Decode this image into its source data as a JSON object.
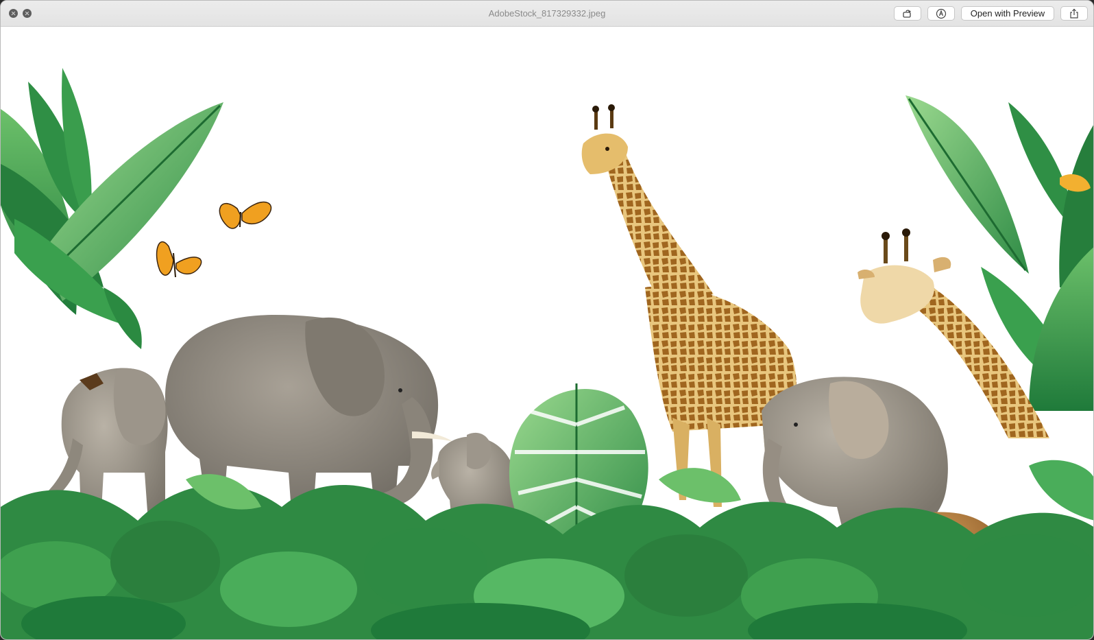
{
  "window": {
    "title": "AdobeStock_817329332.jpeg"
  },
  "toolbar": {
    "open_with_label": "Open with Preview",
    "rotate_icon": "rotate-icon",
    "markup_icon": "markup-pen-icon",
    "share_icon": "share-icon"
  },
  "colors": {
    "leaf_dark": "#1f7a3a",
    "leaf_mid": "#3fa04f",
    "leaf_light": "#7cc47a",
    "elephant_gray": "#8d877e",
    "giraffe_tan": "#d9b062",
    "giraffe_spot": "#8a5a1c",
    "butterfly": "#f0a020"
  }
}
